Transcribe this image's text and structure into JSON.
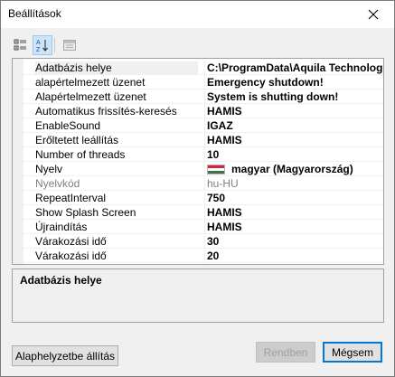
{
  "window": {
    "title": "Beállítások"
  },
  "toolbar": {
    "categorized_icon": "categorized-view-icon",
    "alphabetical_icon": "alphabetical-sort-icon",
    "property_pages_icon": "property-pages-icon"
  },
  "properties": [
    {
      "name": "Adatbázis helye",
      "value": "C:\\ProgramData\\Aquila Technology\\"
    },
    {
      "name": "alapértelmezett üzenet",
      "value": "Emergency shutdown!"
    },
    {
      "name": "Alapértelmezett üzenet",
      "value": "System is shutting down!"
    },
    {
      "name": "Automatikus frissítés-keresés",
      "value": "HAMIS"
    },
    {
      "name": "EnableSound",
      "value": "IGAZ"
    },
    {
      "name": "Erőltetett leállítás",
      "value": "HAMIS"
    },
    {
      "name": "Number of threads",
      "value": "10"
    },
    {
      "name": "Nyelv",
      "value": "magyar (Magyarország)"
    },
    {
      "name": "Nyelvkód",
      "value": "hu-HU"
    },
    {
      "name": "RepeatInterval",
      "value": "750"
    },
    {
      "name": "Show Splash Screen",
      "value": "HAMIS"
    },
    {
      "name": "Újraindítás",
      "value": "HAMIS"
    },
    {
      "name": "Várakozási idő",
      "value": "30"
    },
    {
      "name": "Várakozási idő",
      "value": "20"
    }
  ],
  "flag_colors": [
    "#cd2a3e",
    "#ffffff",
    "#436f4d"
  ],
  "description": {
    "title": "Adatbázis helye"
  },
  "buttons": {
    "reset": "Alaphelyzetbe állítás",
    "ok": "Rendben",
    "cancel": "Mégsem"
  }
}
